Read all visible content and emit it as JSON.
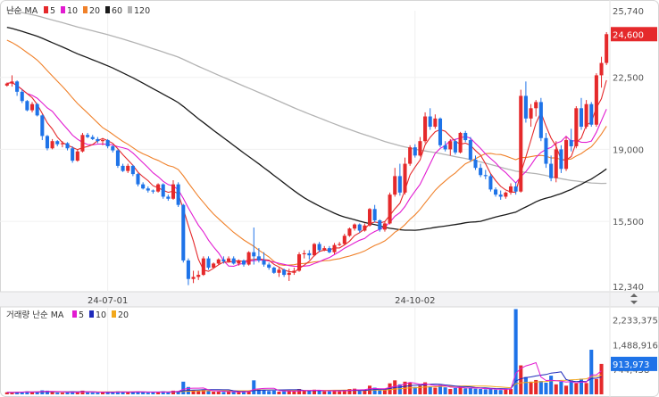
{
  "chart_data": [
    {
      "type": "candlestick",
      "legend": {
        "label": "난순 MA",
        "items": [
          {
            "name": "5",
            "color": "#e5292b"
          },
          {
            "name": "10",
            "color": "#e21bd1"
          },
          {
            "name": "20",
            "color": "#f0812a"
          },
          {
            "name": "60",
            "color": "#1a1a1a"
          },
          {
            "name": "120",
            "color": "#b3b3b3"
          }
        ]
      },
      "y_ticks": [
        "25,740",
        "22,500",
        "19,000",
        "15,500",
        "12,340"
      ],
      "ylim": [
        12340,
        25740
      ],
      "x_ticks": [
        {
          "label": "24-07-01",
          "index": 20
        },
        {
          "label": "24-10-02",
          "index": 81
        }
      ],
      "current_price": "24,600",
      "up_color": "#e5292b",
      "down_color": "#1e73e8",
      "candles": [
        [
          22100,
          22250,
          22050,
          22200
        ],
        [
          22200,
          22600,
          22050,
          22300
        ],
        [
          22300,
          22350,
          21600,
          21800
        ],
        [
          21800,
          21900,
          21250,
          21350
        ],
        [
          21350,
          21400,
          20850,
          20900
        ],
        [
          20900,
          21300,
          20800,
          21200
        ],
        [
          21200,
          21250,
          20600,
          20650
        ],
        [
          20650,
          20700,
          19450,
          19650
        ],
        [
          19650,
          19700,
          18950,
          19050
        ],
        [
          19050,
          19500,
          19000,
          19400
        ],
        [
          19400,
          19450,
          19150,
          19250
        ],
        [
          19250,
          19400,
          19100,
          19300
        ],
        [
          19300,
          19350,
          18950,
          19050
        ],
        [
          19050,
          19150,
          18350,
          18450
        ],
        [
          18450,
          19000,
          18400,
          18900
        ],
        [
          18900,
          19800,
          18850,
          19700
        ],
        [
          19700,
          19800,
          19550,
          19600
        ],
        [
          19600,
          19700,
          19450,
          19500
        ],
        [
          19500,
          19600,
          19300,
          19400
        ],
        [
          19400,
          19550,
          19200,
          19450
        ],
        [
          19450,
          19500,
          19050,
          19150
        ],
        [
          19150,
          19200,
          18850,
          18950
        ],
        [
          18950,
          19000,
          18100,
          18200
        ],
        [
          18200,
          18300,
          17900,
          17950
        ],
        [
          17950,
          18300,
          17850,
          18200
        ],
        [
          18200,
          18250,
          17700,
          17800
        ],
        [
          17800,
          17850,
          17200,
          17300
        ],
        [
          17300,
          17400,
          17050,
          17100
        ],
        [
          17100,
          17200,
          16900,
          17000
        ],
        [
          17000,
          17050,
          16850,
          16950
        ],
        [
          16950,
          17350,
          16900,
          17300
        ],
        [
          17300,
          17350,
          16600,
          16700
        ],
        [
          16700,
          16800,
          16500,
          16600
        ],
        [
          16600,
          17500,
          16550,
          17300
        ],
        [
          17300,
          17400,
          16200,
          16300
        ],
        [
          16300,
          16350,
          13500,
          13600
        ],
        [
          13600,
          13700,
          12400,
          12700
        ],
        [
          12700,
          13100,
          12500,
          12800
        ],
        [
          12800,
          13100,
          12650,
          12900
        ],
        [
          12900,
          13800,
          12850,
          13700
        ],
        [
          13700,
          13800,
          13150,
          13250
        ],
        [
          13250,
          13500,
          13200,
          13450
        ],
        [
          13450,
          13700,
          13400,
          13650
        ],
        [
          13650,
          13800,
          13450,
          13550
        ],
        [
          13550,
          13800,
          13500,
          13700
        ],
        [
          13700,
          13800,
          13400,
          13450
        ],
        [
          13450,
          13650,
          13350,
          13600
        ],
        [
          13600,
          13650,
          13300,
          13400
        ],
        [
          13400,
          14050,
          13350,
          14000
        ],
        [
          14000,
          15200,
          13400,
          13800
        ],
        [
          13800,
          14200,
          13500,
          13600
        ],
        [
          13600,
          14000,
          13300,
          13400
        ],
        [
          13400,
          13500,
          13150,
          13250
        ],
        [
          13250,
          13300,
          12950,
          13000
        ],
        [
          13000,
          13250,
          12800,
          13150
        ],
        [
          13150,
          13200,
          12800,
          12900
        ],
        [
          12900,
          13200,
          12600,
          13000
        ],
        [
          13000,
          13250,
          12900,
          13100
        ],
        [
          13100,
          14000,
          13050,
          13900
        ],
        [
          13900,
          14100,
          13700,
          13950
        ],
        [
          13950,
          14100,
          13650,
          13850
        ],
        [
          13850,
          14450,
          13800,
          14400
        ],
        [
          14400,
          14500,
          14000,
          14100
        ],
        [
          14100,
          14300,
          14050,
          14200
        ],
        [
          14200,
          14300,
          13950,
          14000
        ],
        [
          14000,
          14450,
          13900,
          14350
        ],
        [
          14350,
          14500,
          14300,
          14400
        ],
        [
          14400,
          14900,
          14350,
          14800
        ],
        [
          14800,
          15200,
          14750,
          15150
        ],
        [
          15150,
          15400,
          15050,
          15350
        ],
        [
          15350,
          15400,
          14950,
          15050
        ],
        [
          15050,
          15400,
          15000,
          15300
        ],
        [
          15300,
          16150,
          15250,
          16100
        ],
        [
          16100,
          16300,
          15450,
          15550
        ],
        [
          15550,
          15600,
          15000,
          15100
        ],
        [
          15100,
          15500,
          15000,
          15400
        ],
        [
          15400,
          16900,
          15350,
          16800
        ],
        [
          16800,
          18100,
          16700,
          17700
        ],
        [
          17700,
          18300,
          16750,
          16900
        ],
        [
          16900,
          18600,
          16800,
          18300
        ],
        [
          18300,
          19200,
          18200,
          19100
        ],
        [
          19100,
          19250,
          18600,
          18700
        ],
        [
          18700,
          19600,
          18650,
          19400
        ],
        [
          19400,
          20800,
          19300,
          20600
        ],
        [
          20600,
          21000,
          19950,
          20100
        ],
        [
          20100,
          20700,
          20000,
          20500
        ],
        [
          20500,
          20550,
          19100,
          19200
        ],
        [
          19200,
          19400,
          18900,
          19000
        ],
        [
          19000,
          19500,
          18700,
          19400
        ],
        [
          19400,
          19500,
          18750,
          18850
        ],
        [
          18850,
          19850,
          18800,
          19800
        ],
        [
          19800,
          19900,
          19350,
          19450
        ],
        [
          19450,
          19600,
          18400,
          18500
        ],
        [
          18500,
          18700,
          18000,
          18100
        ],
        [
          18100,
          18300,
          17650,
          17750
        ],
        [
          17750,
          18000,
          17550,
          17700
        ],
        [
          17700,
          17800,
          16950,
          17050
        ],
        [
          17050,
          17150,
          16700,
          16800
        ],
        [
          16800,
          17000,
          16550,
          16700
        ],
        [
          16700,
          16950,
          16600,
          16900
        ],
        [
          16900,
          17350,
          16800,
          17200
        ],
        [
          17200,
          17400,
          16800,
          16950
        ],
        [
          16950,
          21900,
          16900,
          21600
        ],
        [
          21600,
          22300,
          20300,
          20500
        ],
        [
          20500,
          21200,
          20100,
          21000
        ],
        [
          21000,
          21400,
          20600,
          21300
        ],
        [
          21300,
          21500,
          19400,
          19550
        ],
        [
          19550,
          19800,
          18100,
          18300
        ],
        [
          18300,
          18700,
          17450,
          17600
        ],
        [
          17600,
          19400,
          17400,
          19000
        ],
        [
          19000,
          19200,
          17850,
          18050
        ],
        [
          18050,
          19600,
          17950,
          19450
        ],
        [
          19450,
          20000,
          18900,
          19150
        ],
        [
          19150,
          21100,
          19050,
          21000
        ],
        [
          21000,
          21500,
          19950,
          20100
        ],
        [
          20100,
          21400,
          20000,
          21200
        ],
        [
          21200,
          21300,
          20100,
          20200
        ],
        [
          20200,
          22700,
          20100,
          22600
        ],
        [
          22600,
          23500,
          22000,
          23200
        ],
        [
          23200,
          24700,
          23100,
          24600
        ]
      ]
    },
    {
      "type": "bar",
      "legend": {
        "label": "거래량 난순 MA",
        "items": [
          {
            "name": "5",
            "color": "#e21bd1"
          },
          {
            "name": "10",
            "color": "#1f2bbb"
          },
          {
            "name": "20",
            "color": "#f2a81c"
          }
        ]
      },
      "y_ticks": [
        "2,233,375",
        "1,488,916",
        "744,458"
      ],
      "ylim": [
        0,
        2600000
      ],
      "current_value": "913,973",
      "current_value_color": "#1e73e8",
      "volume": [
        60000,
        55000,
        70000,
        80000,
        90000,
        60000,
        70000,
        120000,
        110000,
        70000,
        50000,
        50000,
        60000,
        90000,
        70000,
        110000,
        60000,
        50000,
        50000,
        60000,
        60000,
        70000,
        90000,
        70000,
        60000,
        80000,
        90000,
        60000,
        50000,
        60000,
        70000,
        90000,
        70000,
        110000,
        100000,
        380000,
        220000,
        120000,
        100000,
        130000,
        100000,
        80000,
        80000,
        70000,
        80000,
        80000,
        70000,
        70000,
        110000,
        420000,
        150000,
        130000,
        100000,
        110000,
        80000,
        90000,
        110000,
        80000,
        160000,
        120000,
        100000,
        140000,
        100000,
        90000,
        90000,
        120000,
        90000,
        130000,
        160000,
        170000,
        120000,
        120000,
        260000,
        200000,
        140000,
        120000,
        330000,
        420000,
        300000,
        380000,
        360000,
        220000,
        260000,
        360000,
        240000,
        200000,
        280000,
        210000,
        160000,
        190000,
        220000,
        180000,
        200000,
        170000,
        160000,
        150000,
        170000,
        140000,
        130000,
        160000,
        160000,
        2560000,
        870000,
        520000,
        380000,
        430000,
        400000,
        350000,
        560000,
        300000,
        380000,
        260000,
        420000,
        330000,
        470000,
        340000,
        1340000,
        460000,
        913973
      ]
    }
  ]
}
